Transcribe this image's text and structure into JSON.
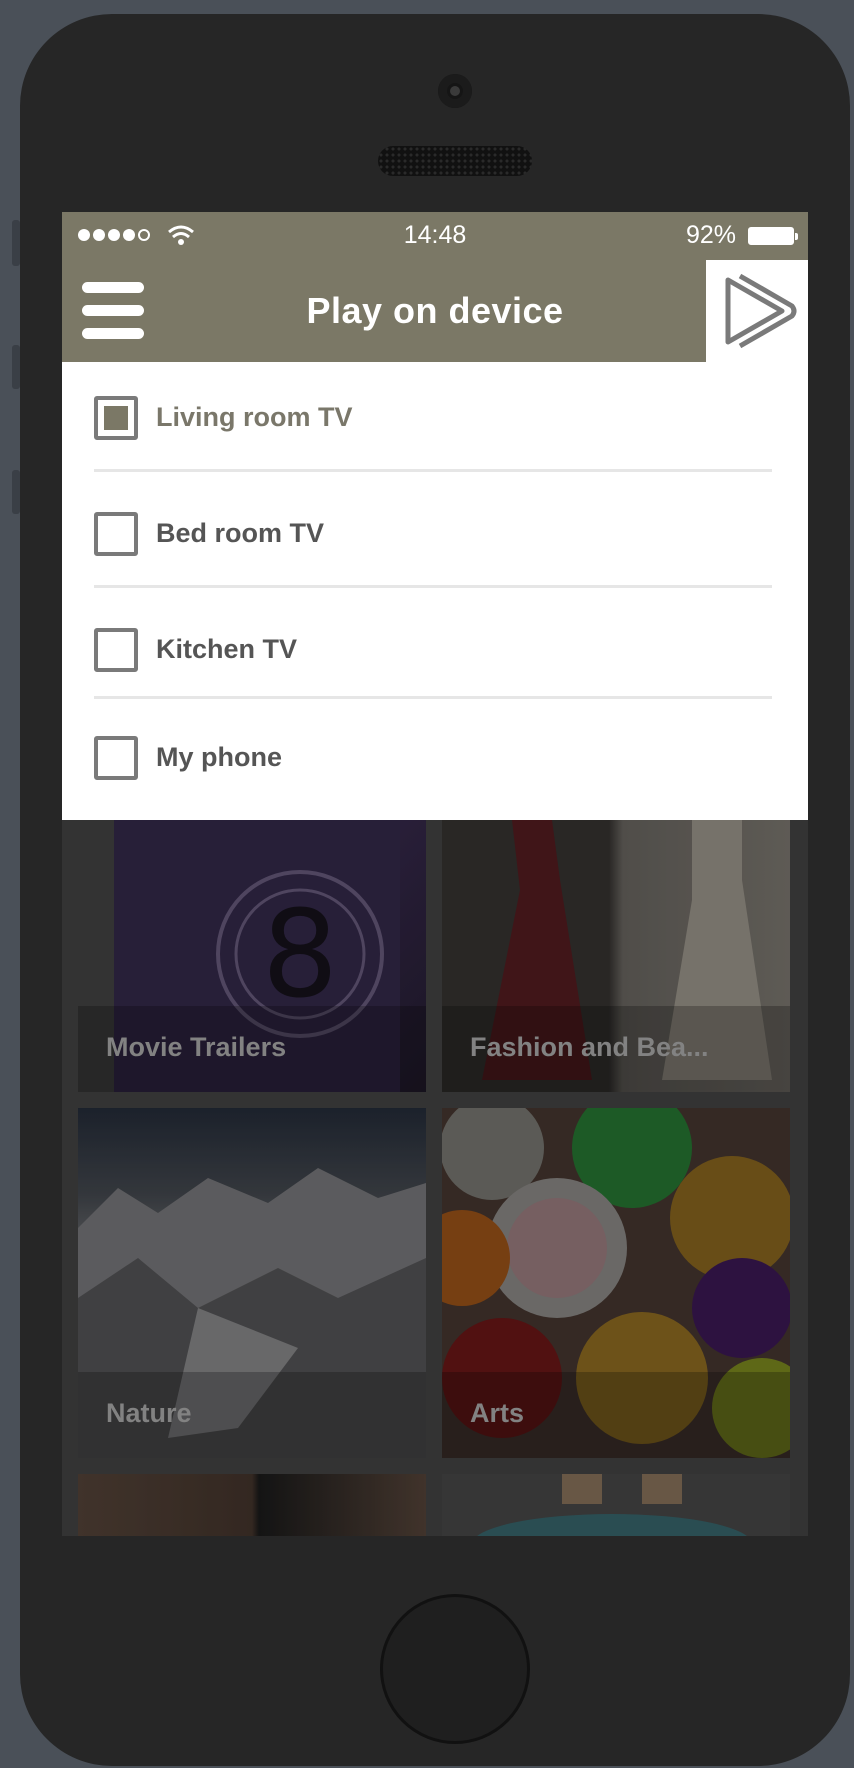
{
  "status_bar": {
    "time": "14:48",
    "battery": "92%"
  },
  "navbar": {
    "title": "Play on device"
  },
  "devices": [
    {
      "label": "Living room TV",
      "checked": true
    },
    {
      "label": "Bed room TV",
      "checked": false
    },
    {
      "label": "Kitchen TV",
      "checked": false
    },
    {
      "label": "My phone",
      "checked": false
    }
  ],
  "categories": [
    {
      "label": "Movie Trailers"
    },
    {
      "label": "Fashion and Bea..."
    },
    {
      "label": "Nature"
    },
    {
      "label": "Arts"
    }
  ],
  "colors": {
    "brand": "#7b7866",
    "panel": "#ffffff",
    "device_frame": "#262626"
  }
}
